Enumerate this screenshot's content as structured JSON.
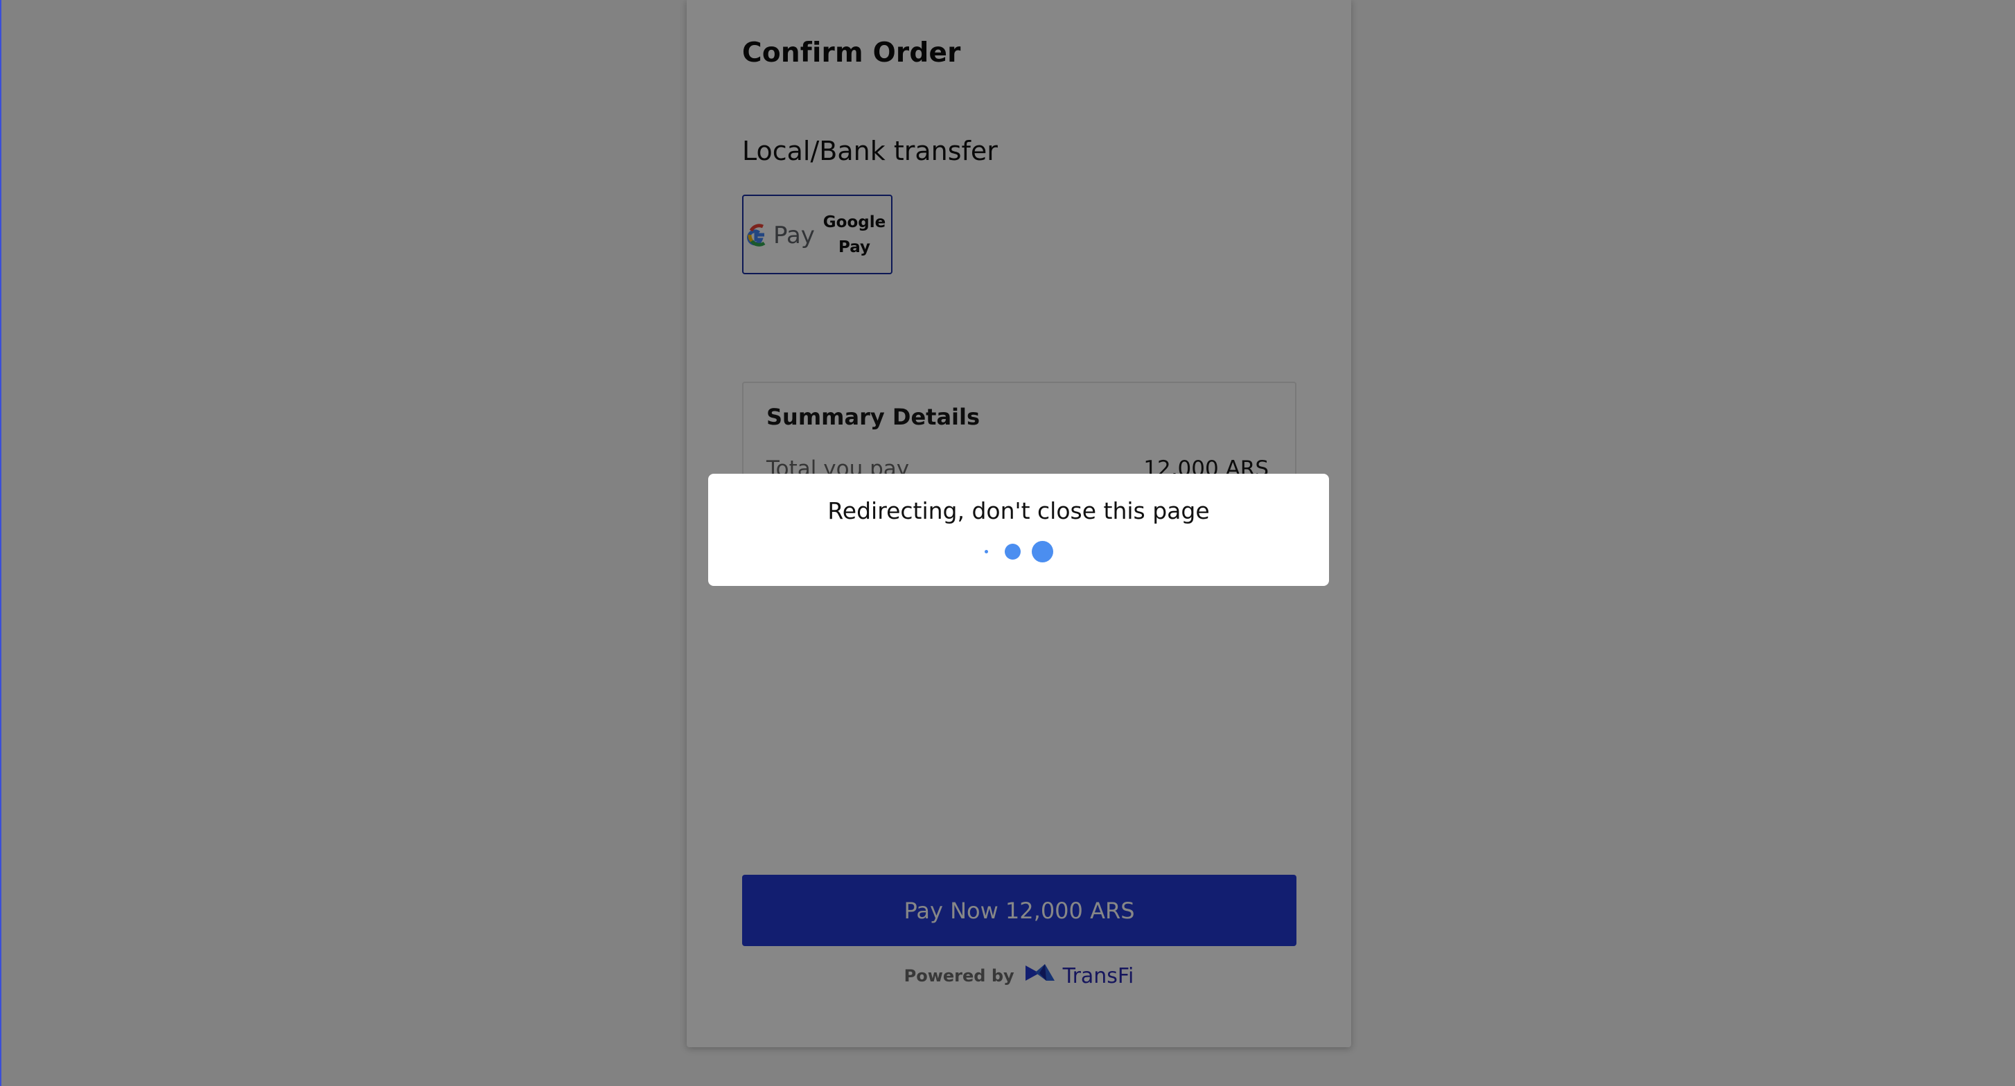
{
  "page": {
    "title": "Confirm Order",
    "payment_section_title": "Local/Bank transfer"
  },
  "payment_methods": [
    {
      "label": "Google Pay",
      "logo_text": "G Pay",
      "icon": "google-pay-icon",
      "selected": true
    }
  ],
  "summary": {
    "title": "Summary Details",
    "total_label": "Total you pay",
    "total_value": "12,000 ARS"
  },
  "pay_button": {
    "label": "Pay Now 12,000 ARS"
  },
  "footer": {
    "powered_by": "Powered by",
    "brand": "TransFi",
    "brand_icon": "transfi-logo-icon"
  },
  "modal": {
    "message": "Redirecting, don't close this page",
    "spinner_icon": "loading-dots-icon"
  },
  "colors": {
    "primary": "#223ad4",
    "spinner": "#4b8ef0",
    "brand_text": "#2a2ab0"
  }
}
